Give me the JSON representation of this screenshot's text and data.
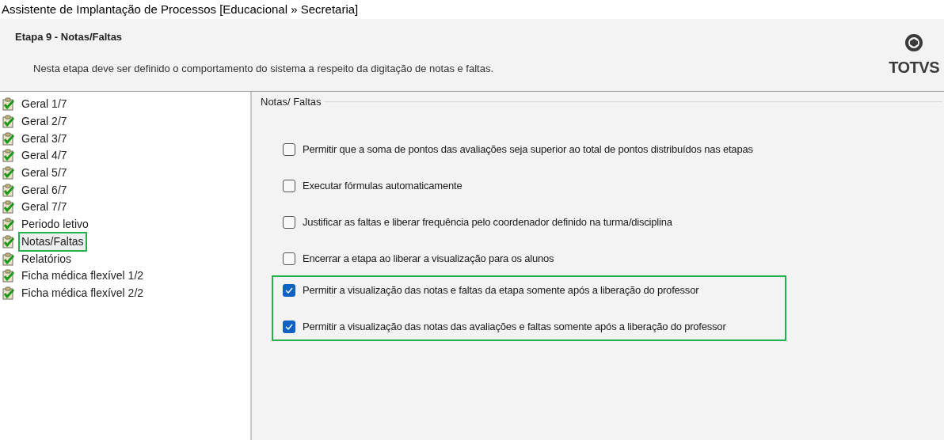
{
  "window": {
    "title": "Assistente de Implantação de Processos [Educacional » Secretaria]"
  },
  "header": {
    "title": "Etapa 9 - Notas/Faltas",
    "description": "Nesta etapa deve ser definido o comportamento do sistema a respeito da digitação de notas e faltas.",
    "logo": "TOTVS"
  },
  "steps": [
    {
      "label": "Geral 1/7",
      "selected": false,
      "done": true
    },
    {
      "label": "Geral 2/7",
      "selected": false,
      "done": true
    },
    {
      "label": "Geral 3/7",
      "selected": false,
      "done": true
    },
    {
      "label": "Geral 4/7",
      "selected": false,
      "done": true
    },
    {
      "label": "Geral 5/7",
      "selected": false,
      "done": true
    },
    {
      "label": "Geral 6/7",
      "selected": false,
      "done": true
    },
    {
      "label": "Geral 7/7",
      "selected": false,
      "done": true
    },
    {
      "label": "Periodo letivo",
      "selected": false,
      "done": true
    },
    {
      "label": "Notas/Faltas",
      "selected": true,
      "done": true
    },
    {
      "label": "Relatórios",
      "selected": false,
      "done": true
    },
    {
      "label": "Ficha médica flexível 1/2",
      "selected": false,
      "done": true
    },
    {
      "label": "Ficha médica flexível 2/2",
      "selected": false,
      "done": true
    }
  ],
  "group": {
    "title": "Notas/ Faltas",
    "options": [
      {
        "label": "Permitir que a soma de pontos das avaliações seja superior ao total de pontos distribuídos nas etapas",
        "checked": false,
        "highlighted": false
      },
      {
        "label": "Executar fórmulas automaticamente",
        "checked": false,
        "highlighted": false
      },
      {
        "label": "Justificar as faltas e liberar frequência pelo coordenador definido na turma/disciplina",
        "checked": false,
        "highlighted": false
      },
      {
        "label": "Encerrar a etapa ao liberar a visualização para os alunos",
        "checked": false,
        "highlighted": false
      },
      {
        "label": "Permitir a visualização das notas e faltas da etapa somente após a liberação do professor",
        "checked": true,
        "highlighted": true
      },
      {
        "label": "Permitir a visualização das notas das avaliações e faltas somente após a liberação do professor",
        "checked": true,
        "highlighted": true
      }
    ]
  }
}
